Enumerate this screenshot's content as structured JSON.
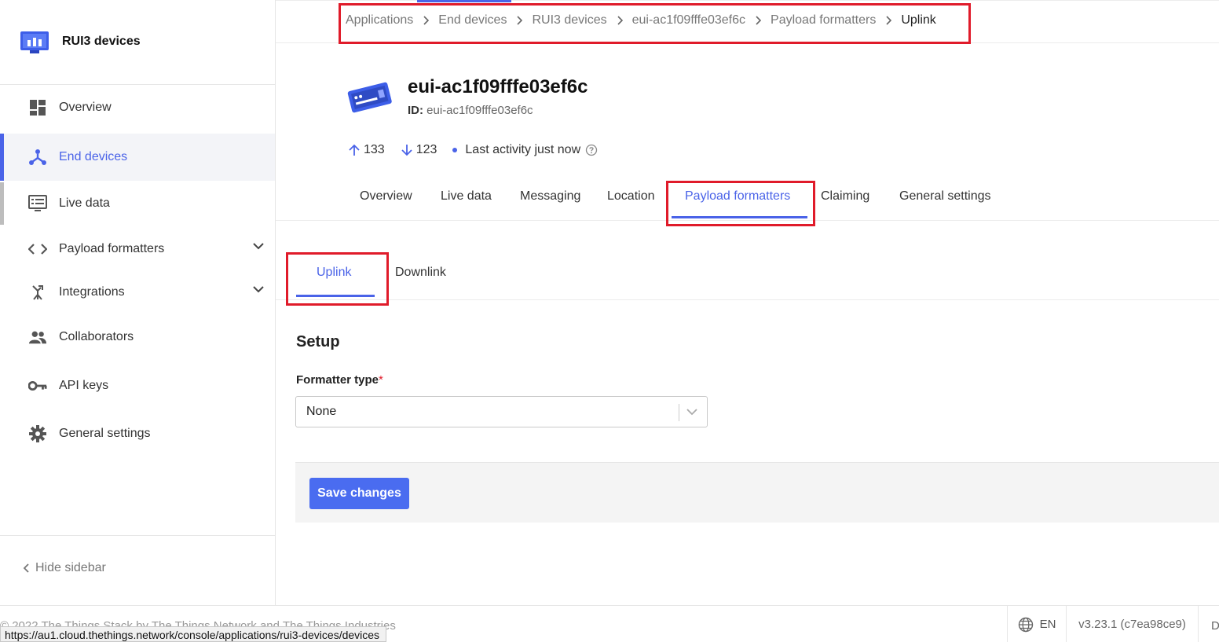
{
  "app": {
    "name": "RUI3 devices"
  },
  "sidebar": {
    "items": [
      {
        "label": "Overview"
      },
      {
        "label": "End devices"
      },
      {
        "label": "Live data"
      },
      {
        "label": "Payload formatters"
      },
      {
        "label": "Integrations"
      },
      {
        "label": "Collaborators"
      },
      {
        "label": "API keys"
      },
      {
        "label": "General settings"
      }
    ],
    "hide_label": "Hide sidebar"
  },
  "breadcrumbs": [
    "Applications",
    "End devices",
    "RUI3 devices",
    "eui-ac1f09fffe03ef6c",
    "Payload formatters",
    "Uplink"
  ],
  "device": {
    "title": "eui-ac1f09fffe03ef6c",
    "id_label": "ID:",
    "id_value": "eui-ac1f09fffe03ef6c",
    "uplink_count": "133",
    "downlink_count": "123",
    "last_activity": "Last activity just now"
  },
  "tabs": [
    "Overview",
    "Live data",
    "Messaging",
    "Location",
    "Payload formatters",
    "Claiming",
    "General settings"
  ],
  "subtabs": [
    "Uplink",
    "Downlink"
  ],
  "form": {
    "section_title": "Setup",
    "formatter_label": "Formatter type",
    "required_mark": "*",
    "formatter_value": "None",
    "save_label": "Save changes"
  },
  "footer": {
    "copyright": "© 2022 The Things Stack by The Things Network and The Things Industries",
    "language": "EN",
    "version": "v3.23.1 (c7ea98ce9)",
    "docs": "Do"
  },
  "status_url": "https://au1.cloud.thethings.network/console/applications/rui3-devices/devices",
  "colors": {
    "accent": "#4a63e8",
    "highlight_box": "#e01b2a"
  }
}
